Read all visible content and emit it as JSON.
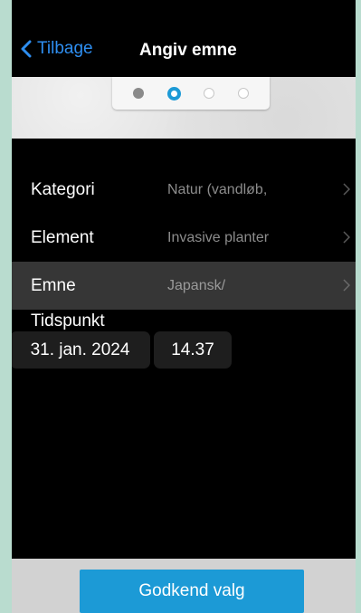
{
  "navbar": {
    "back_label": "Tilbage",
    "title": "Angiv emne"
  },
  "stepper": {
    "steps": [
      "done",
      "active",
      "todo",
      "todo"
    ]
  },
  "rows": [
    {
      "label": "Kategori",
      "value": "Natur (vandløb,"
    },
    {
      "label": "Element",
      "value": "Invasive planter"
    },
    {
      "label": "Emne",
      "value": "Japansk/"
    }
  ],
  "time": {
    "label": "Tidspunkt",
    "date": "31. jan. 2024",
    "clock": "14.37"
  },
  "footer": {
    "confirm_label": "Godkend valg"
  },
  "colors": {
    "accent": "#1c9ad6",
    "link": "#2e8ef0",
    "selected_row": "#363636"
  }
}
